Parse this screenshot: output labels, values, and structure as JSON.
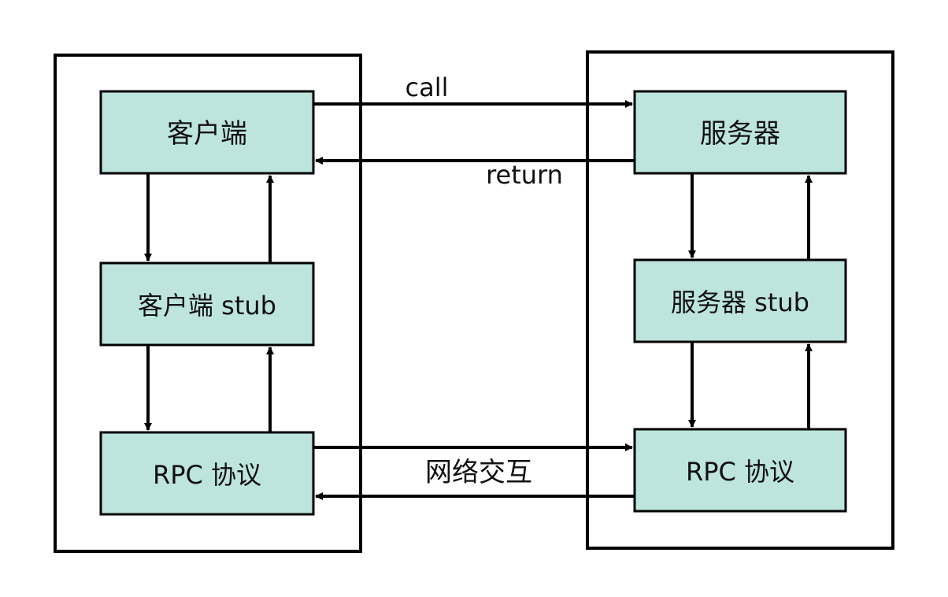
{
  "client": {
    "app_label": "客户端",
    "stub_label": "客户端 stub",
    "protocol_label": "RPC 协议"
  },
  "server": {
    "app_label": "服务器",
    "stub_label": "服务器 stub",
    "protocol_label": "RPC 协议"
  },
  "links": {
    "call_label": "call",
    "return_label": "return",
    "network_label": "网络交互"
  },
  "colors": {
    "box_fill": "#bde5de",
    "stroke": "#000000"
  }
}
